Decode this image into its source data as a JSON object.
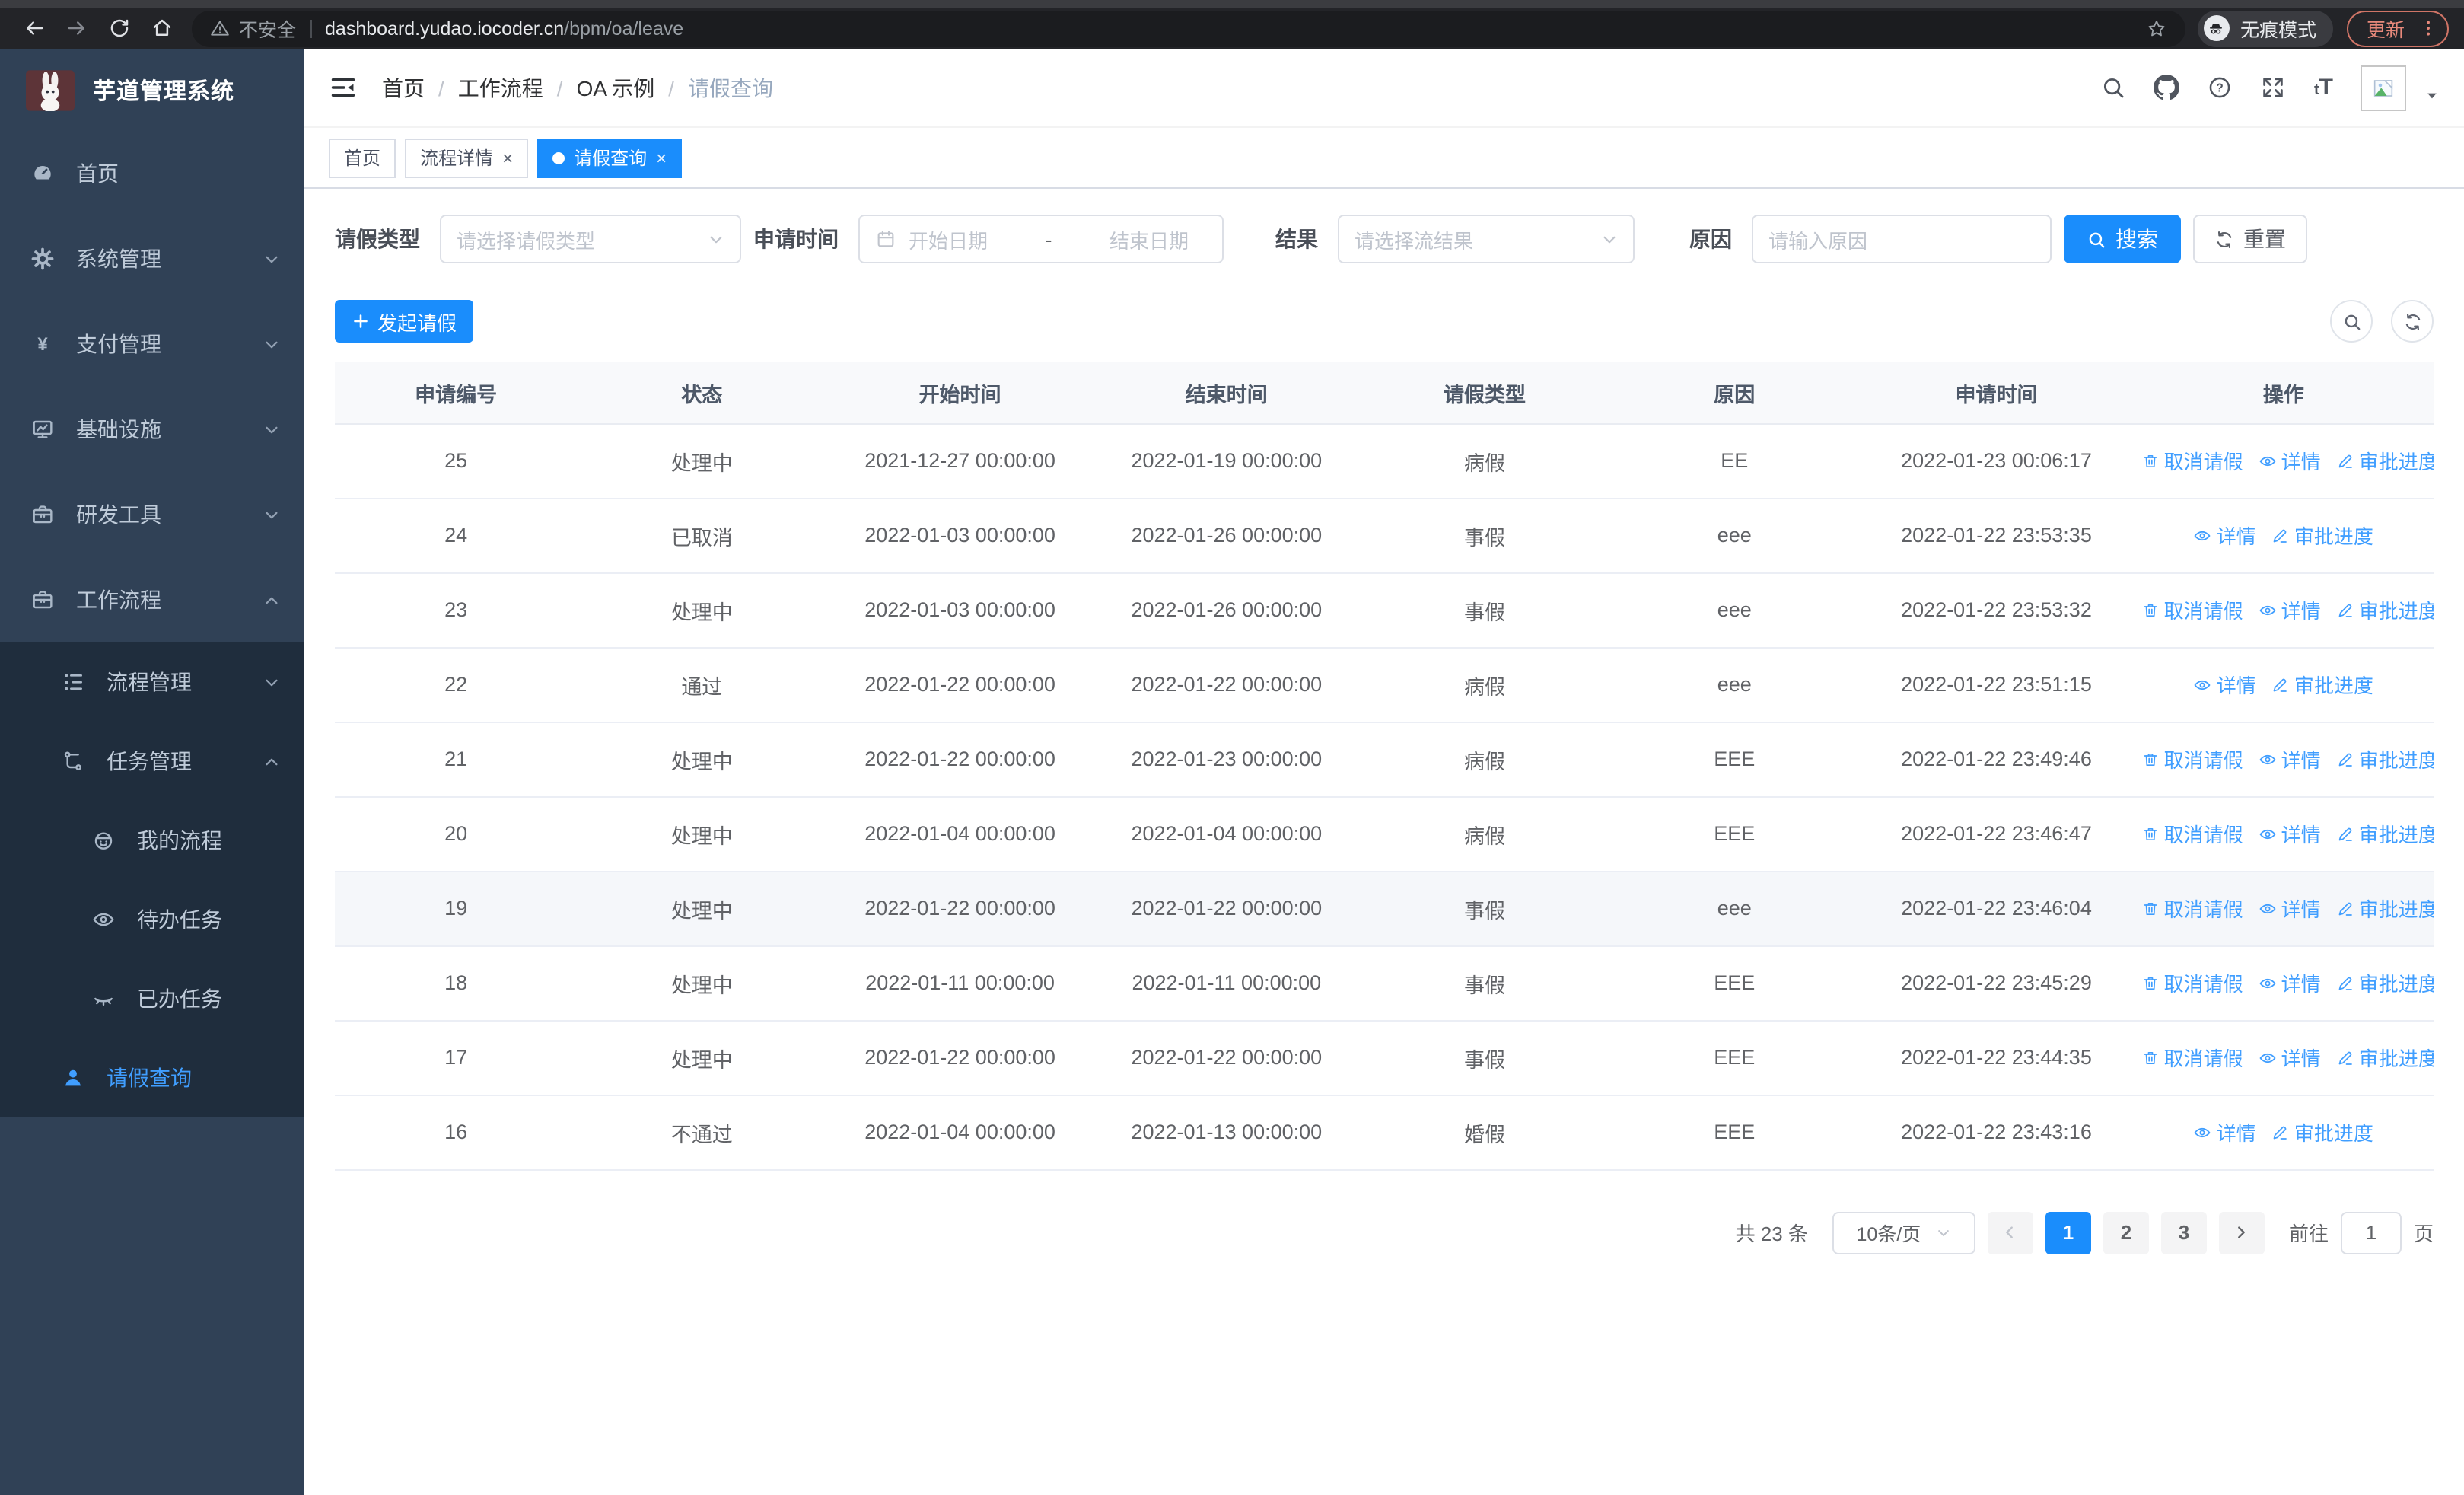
{
  "browser": {
    "nav_icons": [
      "back-icon",
      "forward-icon",
      "reload-icon",
      "home-icon"
    ],
    "security_label": "不安全",
    "url_host": "dashboard.yudao.iocoder.cn",
    "url_path": "/bpm/oa/leave",
    "incognito_label": "无痕模式",
    "update_label": "更新"
  },
  "sidebar": {
    "title": "芋道管理系统",
    "menu": [
      {
        "label": "首页",
        "icon": "dashboard-icon",
        "level": 1
      },
      {
        "label": "系统管理",
        "icon": "gear-icon",
        "level": 1,
        "chevron": "down"
      },
      {
        "label": "支付管理",
        "icon": "yen-icon",
        "level": 1,
        "chevron": "down"
      },
      {
        "label": "基础设施",
        "icon": "monitor-icon",
        "level": 1,
        "chevron": "down"
      },
      {
        "label": "研发工具",
        "icon": "briefcase-icon",
        "level": 1,
        "chevron": "down"
      },
      {
        "label": "工作流程",
        "icon": "briefcase-icon",
        "level": 1,
        "chevron": "up"
      },
      {
        "label": "流程管理",
        "icon": "tree-list-icon",
        "level": 2,
        "chevron": "down",
        "submenu": true
      },
      {
        "label": "任务管理",
        "icon": "flow-icon",
        "level": 2,
        "chevron": "up",
        "submenu": true
      },
      {
        "label": "我的流程",
        "icon": "face-icon",
        "level": 3,
        "submenu": true
      },
      {
        "label": "待办任务",
        "icon": "eye-open-icon",
        "level": 3,
        "submenu": true
      },
      {
        "label": "已办任务",
        "icon": "eye-closed-icon",
        "level": 3,
        "submenu": true
      },
      {
        "label": "请假查询",
        "icon": "user-icon",
        "level": 2,
        "submenu": true,
        "active": true
      }
    ]
  },
  "header": {
    "breadcrumb": [
      {
        "label": "首页"
      },
      {
        "label": "工作流程"
      },
      {
        "label": "OA 示例"
      },
      {
        "label": "请假查询",
        "current": true
      }
    ],
    "icons": [
      "search-icon",
      "github-icon",
      "help-icon",
      "fullscreen-icon",
      "font-size-icon"
    ]
  },
  "tabs": [
    {
      "label": "首页",
      "active": false,
      "closable": false
    },
    {
      "label": "流程详情",
      "active": false,
      "closable": true
    },
    {
      "label": "请假查询",
      "active": true,
      "closable": true
    }
  ],
  "filters": {
    "leave_type": {
      "label": "请假类型",
      "placeholder": "请选择请假类型"
    },
    "apply_time": {
      "label": "申请时间",
      "start_placeholder": "开始日期",
      "separator": "-",
      "end_placeholder": "结束日期"
    },
    "result": {
      "label": "结果",
      "placeholder": "请选择流结果"
    },
    "reason": {
      "label": "原因",
      "placeholder": "请输入原因"
    },
    "search_label": "搜索",
    "reset_label": "重置"
  },
  "toolbar": {
    "create_label": "发起请假"
  },
  "table": {
    "columns": [
      "申请编号",
      "状态",
      "开始时间",
      "结束时间",
      "请假类型",
      "原因",
      "申请时间",
      "操作"
    ],
    "action_labels": {
      "cancel": "取消请假",
      "detail": "详情",
      "progress": "审批进度"
    },
    "action_icons": {
      "cancel": "trash-icon",
      "detail": "view-icon",
      "progress": "edit-icon"
    },
    "rows": [
      {
        "id": "25",
        "status": "处理中",
        "start": "2021-12-27 00:00:00",
        "end": "2022-01-19 00:00:00",
        "type": "病假",
        "reason": "EE",
        "apply_time": "2022-01-23 00:06:17",
        "actions": [
          "cancel",
          "detail",
          "progress"
        ],
        "highlight": false
      },
      {
        "id": "24",
        "status": "已取消",
        "start": "2022-01-03 00:00:00",
        "end": "2022-01-26 00:00:00",
        "type": "事假",
        "reason": "eee",
        "apply_time": "2022-01-22 23:53:35",
        "actions": [
          "detail",
          "progress"
        ],
        "highlight": false
      },
      {
        "id": "23",
        "status": "处理中",
        "start": "2022-01-03 00:00:00",
        "end": "2022-01-26 00:00:00",
        "type": "事假",
        "reason": "eee",
        "apply_time": "2022-01-22 23:53:32",
        "actions": [
          "cancel",
          "detail",
          "progress"
        ],
        "highlight": false
      },
      {
        "id": "22",
        "status": "通过",
        "start": "2022-01-22 00:00:00",
        "end": "2022-01-22 00:00:00",
        "type": "病假",
        "reason": "eee",
        "apply_time": "2022-01-22 23:51:15",
        "actions": [
          "detail",
          "progress"
        ],
        "highlight": false
      },
      {
        "id": "21",
        "status": "处理中",
        "start": "2022-01-22 00:00:00",
        "end": "2022-01-23 00:00:00",
        "type": "病假",
        "reason": "EEE",
        "apply_time": "2022-01-22 23:49:46",
        "actions": [
          "cancel",
          "detail",
          "progress"
        ],
        "highlight": false
      },
      {
        "id": "20",
        "status": "处理中",
        "start": "2022-01-04 00:00:00",
        "end": "2022-01-04 00:00:00",
        "type": "病假",
        "reason": "EEE",
        "apply_time": "2022-01-22 23:46:47",
        "actions": [
          "cancel",
          "detail",
          "progress"
        ],
        "highlight": false
      },
      {
        "id": "19",
        "status": "处理中",
        "start": "2022-01-22 00:00:00",
        "end": "2022-01-22 00:00:00",
        "type": "事假",
        "reason": "eee",
        "apply_time": "2022-01-22 23:46:04",
        "actions": [
          "cancel",
          "detail",
          "progress"
        ],
        "highlight": true
      },
      {
        "id": "18",
        "status": "处理中",
        "start": "2022-01-11 00:00:00",
        "end": "2022-01-11 00:00:00",
        "type": "事假",
        "reason": "EEE",
        "apply_time": "2022-01-22 23:45:29",
        "actions": [
          "cancel",
          "detail",
          "progress"
        ],
        "highlight": false
      },
      {
        "id": "17",
        "status": "处理中",
        "start": "2022-01-22 00:00:00",
        "end": "2022-01-22 00:00:00",
        "type": "事假",
        "reason": "EEE",
        "apply_time": "2022-01-22 23:44:35",
        "actions": [
          "cancel",
          "detail",
          "progress"
        ],
        "highlight": false
      },
      {
        "id": "16",
        "status": "不通过",
        "start": "2022-01-04 00:00:00",
        "end": "2022-01-13 00:00:00",
        "type": "婚假",
        "reason": "EEE",
        "apply_time": "2022-01-22 23:43:16",
        "actions": [
          "detail",
          "progress"
        ],
        "highlight": false
      }
    ]
  },
  "pagination": {
    "total_label": "共 23 条",
    "page_size_value": "10条/页",
    "pages": [
      "1",
      "2",
      "3"
    ],
    "current_page": "1",
    "goto_label": "前往",
    "goto_value": "1",
    "page_unit_label": "页"
  },
  "colors": {
    "accent": "#1a8dfc",
    "link": "#409eff",
    "sidebar_bg": "#304156",
    "submenu_bg": "#1f2d3d",
    "update_pill": "#e8897b"
  }
}
